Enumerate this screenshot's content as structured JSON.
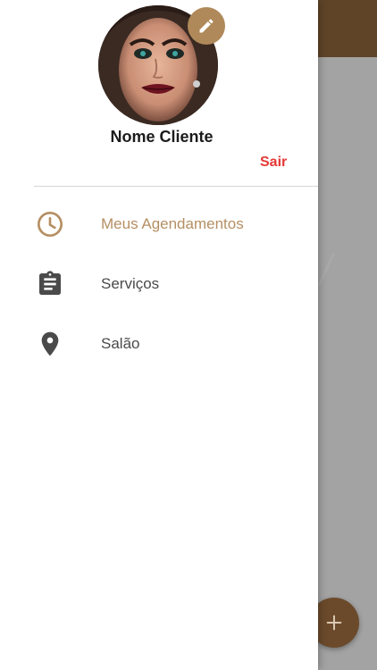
{
  "drawer": {
    "user_name": "Nome Cliente",
    "logout_label": "Sair",
    "avatar_icon": "profile-photo",
    "edit_icon": "pencil-icon",
    "items": [
      {
        "label": "Meus Agendamentos",
        "icon": "clock-icon",
        "active": true
      },
      {
        "label": "Serviços",
        "icon": "clipboard-icon",
        "active": false
      },
      {
        "label": "Salão",
        "icon": "location-pin-icon",
        "active": false
      }
    ]
  },
  "background": {
    "fab_icon": "plus-icon"
  },
  "colors": {
    "accent": "#b58f63",
    "app_bar": "#5f4428",
    "logout": "#e53935",
    "icon_default": "#4a4a4a"
  }
}
